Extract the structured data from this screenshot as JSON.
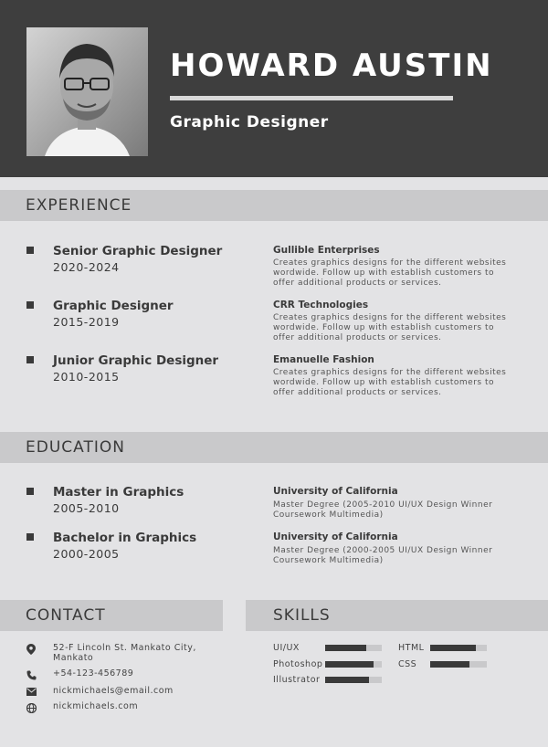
{
  "header": {
    "name": "HOWARD AUSTIN",
    "title": "Graphic Designer"
  },
  "experience": {
    "heading": "EXPERIENCE",
    "items": [
      {
        "role": "Senior Graphic Designer",
        "years": "2020-2024",
        "org": "Gullible Enterprises",
        "desc": "Creates graphics designs for the different websites wordwide. Follow up with establish customers to offer additional products or services."
      },
      {
        "role": "Graphic Designer",
        "years": "2015-2019",
        "org": "CRR Technologies",
        "desc": "Creates graphics designs for the different websites wordwide. Follow up with establish customers to offer additional products or services."
      },
      {
        "role": "Junior Graphic Designer",
        "years": "2010-2015",
        "org": "Emanuelle Fashion",
        "desc": "Creates graphics designs for the different websites wordwide. Follow up with establish customers to offer additional products or services."
      }
    ]
  },
  "education": {
    "heading": "EDUCATION",
    "items": [
      {
        "role": "Master in Graphics",
        "years": "2005-2010",
        "org": "University of California",
        "desc": "Master Degree (2005-2010 UI/UX Design Winner Coursework Multimedia)"
      },
      {
        "role": "Bachelor in Graphics",
        "years": "2000-2005",
        "org": "University of California",
        "desc": "Master Degree (2000-2005 UI/UX Design Winner Coursework Multimedia)"
      }
    ]
  },
  "contact": {
    "heading": "CONTACT",
    "address": "52-F Lincoln St. Mankato City, Mankato",
    "phone": "+54-123-456789",
    "email": "nickmichaels@email.com",
    "website": "nickmichaels.com"
  },
  "skills": {
    "heading": "SKILLS",
    "items": [
      {
        "name": "UI/UX",
        "level": 0.72
      },
      {
        "name": "HTML",
        "level": 0.8
      },
      {
        "name": "Photoshop",
        "level": 0.85
      },
      {
        "name": "CSS",
        "level": 0.7
      },
      {
        "name": "Illustrator",
        "level": 0.78
      }
    ]
  },
  "colors": {
    "header_bg": "#3e3e3e",
    "page_bg": "#e3e3e5",
    "section_bar": "#c9c9cb",
    "accent_dark": "#3a3a3a"
  },
  "icons": {
    "address": "location-pin-icon",
    "phone": "phone-icon",
    "email": "envelope-icon",
    "website": "globe-icon"
  }
}
